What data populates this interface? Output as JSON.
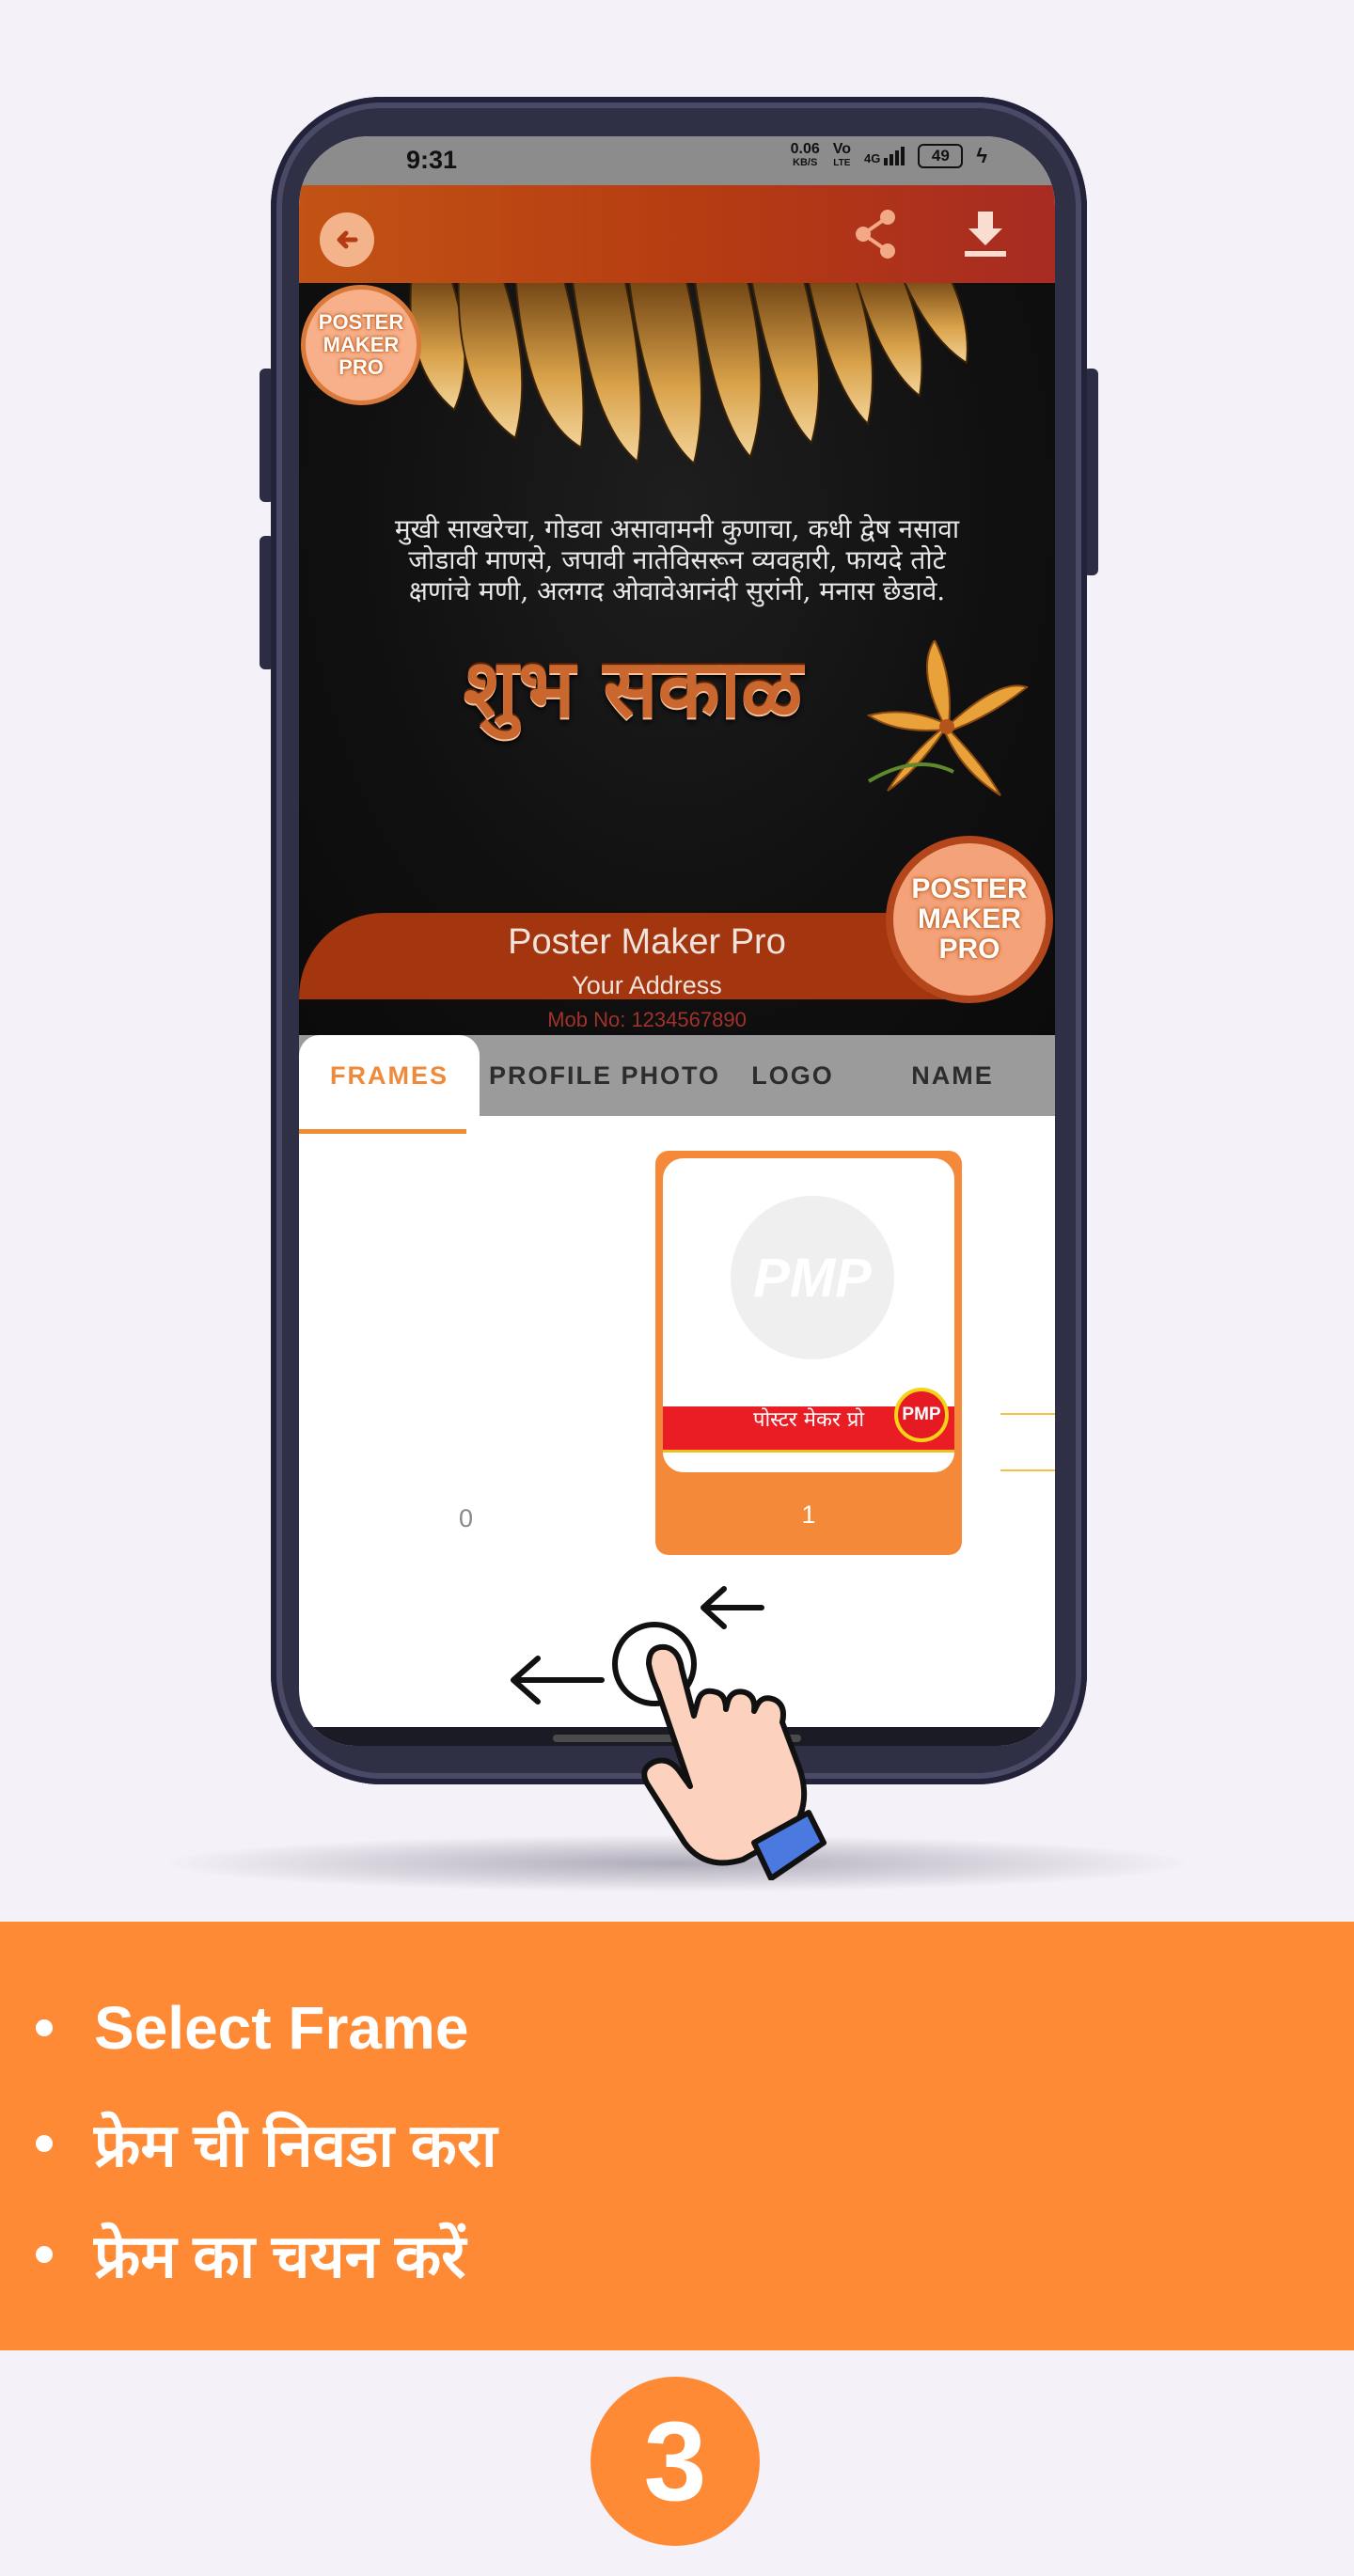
{
  "status_bar": {
    "time": "9:31",
    "speed_value": "0.06",
    "speed_unit": "KB/S",
    "volte_top": "Vo",
    "volte_bottom": "LTE",
    "network": "4G",
    "battery": "49"
  },
  "toolbar": {
    "back_icon": "arrow-left-icon",
    "share_icon": "share-icon",
    "download_icon": "download-icon"
  },
  "poster": {
    "logo_text": [
      "POSTER",
      "MAKER",
      "PRO"
    ],
    "quote_lines": [
      "मुखी साखरेचा, गोडवा असावामनी कुणाचा, कधी द्वेष नसावा",
      "जोडावी माणसे, जपावी नातेविसरून व्यवहारी, फायदे तोटे",
      "क्षणांचे मणी, अलगद ओवावेआनंदी सुरांनी, मनास छेडावे."
    ],
    "greeting": "शुभ सकाळ",
    "name": "Poster Maker Pro",
    "address": "Your Address",
    "mobile": "Mob No: 1234567890"
  },
  "tabs": [
    {
      "label": "FRAMES",
      "active": true
    },
    {
      "label": "PROFILE PHOTO",
      "active": false
    },
    {
      "label": "LOGO",
      "active": false
    },
    {
      "label": "NAME",
      "active": false
    }
  ],
  "frames": [
    {
      "label": "0"
    },
    {
      "label": "1",
      "photo_text": "PMP",
      "banner_text": "पोस्टर मेकर प्रो",
      "badge_text": "PMP"
    }
  ],
  "instructions": [
    "Select Frame",
    "फ्रेम ची निवडा करा",
    "फ्रेम का चयन करें"
  ],
  "step_number": "3",
  "colors": {
    "accent": "#fe8a36",
    "toolbar": "#b53b12",
    "background": "#f5f1f8"
  }
}
